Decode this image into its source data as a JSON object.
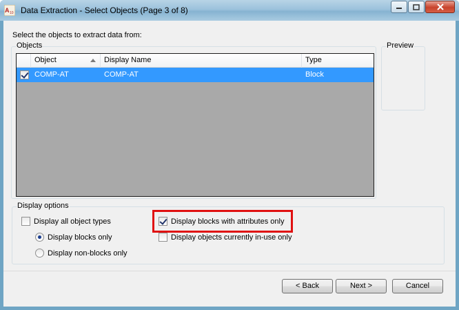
{
  "window": {
    "title": "Data Extraction - Select Objects (Page 3 of 8)",
    "app_icon": "autocad-icon",
    "controls": [
      "minimize-icon",
      "maximize-icon",
      "close-icon"
    ]
  },
  "instruction": "Select the objects to extract data from:",
  "objects_group": {
    "label": "Objects",
    "columns": [
      "Object",
      "Display Name",
      "Type"
    ],
    "sorted_column": "Object",
    "rows": [
      {
        "checked": true,
        "object": "COMP-AT",
        "display_name": "COMP-AT",
        "type": "Block",
        "selected": true
      }
    ]
  },
  "preview_group": {
    "label": "Preview"
  },
  "display_options": {
    "label": "Display options",
    "all_types": {
      "label": "Display all object types",
      "checked": false
    },
    "blocks_only": {
      "label": "Display blocks only",
      "selected": true
    },
    "non_blocks_only": {
      "label": "Display non-blocks only",
      "selected": false
    },
    "with_attributes": {
      "label": "Display blocks with attributes only",
      "checked": true
    },
    "in_use": {
      "label": "Display objects currently in-use only",
      "checked": false
    }
  },
  "buttons": {
    "back": "< Back",
    "next": "Next >",
    "cancel": "Cancel"
  },
  "colors": {
    "selection": "#3399ff",
    "highlight": "#e01010",
    "list_bg": "#a9a9a9"
  }
}
